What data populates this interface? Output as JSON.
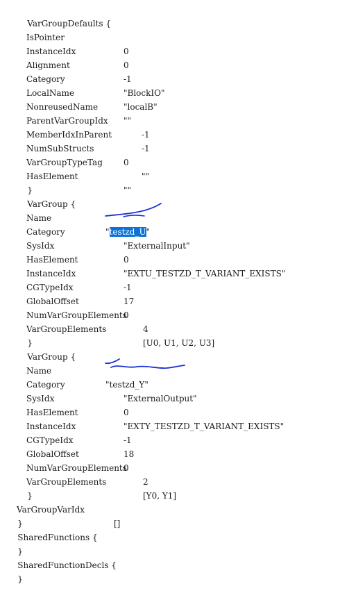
{
  "lines": [
    {
      "key": "VarGroupDefaults {",
      "value": ""
    },
    {
      "key": "IsPointer",
      "value": "0"
    },
    {
      "key": "InstanceIdx",
      "value": "0"
    },
    {
      "key": "Alignment",
      "value": "-1"
    },
    {
      "key": "Category",
      "value": "\"BlockIO\""
    },
    {
      "key": "LocalName",
      "value": "\"localB\""
    },
    {
      "key": "NonreusedName",
      "value": "\"\""
    },
    {
      "key": "ParentVarGroupIdx",
      "value": "-1"
    },
    {
      "key": "MemberIdxInParent",
      "value": "-1"
    },
    {
      "key": "NumSubStructs",
      "value": "0"
    },
    {
      "key": "VarGroupTypeTag",
      "value": "\"\""
    },
    {
      "key": "HasElement",
      "value": "\"\""
    },
    {
      "key": "}",
      "value": ""
    },
    {
      "key": "VarGroup {",
      "value": ""
    },
    {
      "key": "Name",
      "value": "\"testzd_U\""
    },
    {
      "key": "Category",
      "value": "\"ExternalInput\""
    },
    {
      "key": "SysIdx",
      "value": "0"
    },
    {
      "key": "HasElement",
      "value": "\"EXTU_TESTZD_T_VARIANT_EXISTS\""
    },
    {
      "key": "InstanceIdx",
      "value": "-1"
    },
    {
      "key": "CGTypeIdx",
      "value": "17"
    },
    {
      "key": "GlobalOffset",
      "value": "0"
    },
    {
      "key": "NumVarGroupElements",
      "value": "4"
    },
    {
      "key": "VarGroupElements",
      "value": "[U0, U1, U2, U3]"
    },
    {
      "key": "}",
      "value": ""
    },
    {
      "key": "VarGroup {",
      "value": ""
    },
    {
      "key": "Name",
      "value": "\"testzd_Y\""
    },
    {
      "key": "Category",
      "value": "\"ExternalOutput\""
    },
    {
      "key": "SysIdx",
      "value": "0"
    },
    {
      "key": "HasElement",
      "value": "\"EXTY_TESTZD_T_VARIANT_EXISTS\""
    },
    {
      "key": "InstanceIdx",
      "value": "-1"
    },
    {
      "key": "CGTypeIdx",
      "value": "18"
    },
    {
      "key": "GlobalOffset",
      "value": "0"
    },
    {
      "key": "NumVarGroupElements",
      "value": "2"
    },
    {
      "key": "VarGroupElements",
      "value": "[Y0, Y1]"
    },
    {
      "key": "}",
      "value": ""
    },
    {
      "key": "VarGroupVarIdx",
      "value": "[]"
    },
    {
      "key": "}",
      "value": ""
    },
    {
      "key": "SharedFunctions {",
      "value": ""
    },
    {
      "key": "}",
      "value": ""
    },
    {
      "key": "SharedFunctionDecls {",
      "value": ""
    },
    {
      "key": "}",
      "value": ""
    }
  ],
  "selection": {
    "text": "testzd_U",
    "color": "#0a73d9"
  },
  "annotation": {
    "ink_color": "#1a2fd6"
  }
}
